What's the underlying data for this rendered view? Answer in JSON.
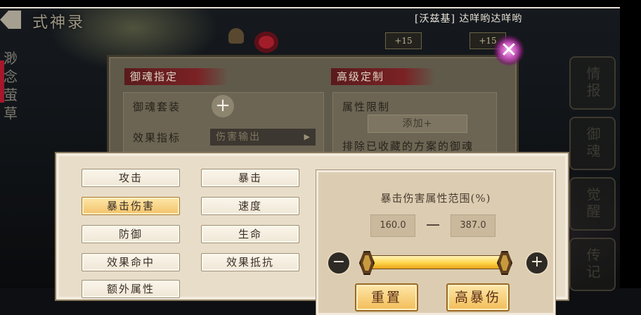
{
  "header": {
    "title": "式神录",
    "player_tag": "[沃兹基] 达咩哟达咩哟"
  },
  "background": {
    "chips": [
      "+15",
      "+15"
    ],
    "left_tabs": [
      "渺",
      "念",
      "萤",
      "草"
    ],
    "right_tabs": [
      "情报",
      "御魂",
      "觉醒",
      "传记"
    ]
  },
  "back_dialog": {
    "section_left": "御魂指定",
    "section_right": "高级定制",
    "set_label": "御魂套装",
    "effect_label": "效果指标",
    "effect_value": "伤害输出",
    "attr_limit_label": "属性限制",
    "add_label": "添加+",
    "exclude_label": "排除已收藏的方案的御魂"
  },
  "attributes": [
    {
      "label": "攻击",
      "selected": false
    },
    {
      "label": "暴击",
      "selected": false
    },
    {
      "label": "暴击伤害",
      "selected": true
    },
    {
      "label": "速度",
      "selected": false
    },
    {
      "label": "防御",
      "selected": false
    },
    {
      "label": "生命",
      "selected": false
    },
    {
      "label": "效果命中",
      "selected": false
    },
    {
      "label": "效果抵抗",
      "selected": false
    },
    {
      "label": "额外属性",
      "selected": false
    }
  ],
  "range": {
    "title": "暴击伤害属性范围(%)",
    "min": "160.0",
    "max": "387.0",
    "reset_label": "重置",
    "preset_label": "高暴伤"
  },
  "colors": {
    "accent_gold": "#f2c26a",
    "panel_cream": "#e8ddc8",
    "ribbon_red": "#7a2224"
  }
}
